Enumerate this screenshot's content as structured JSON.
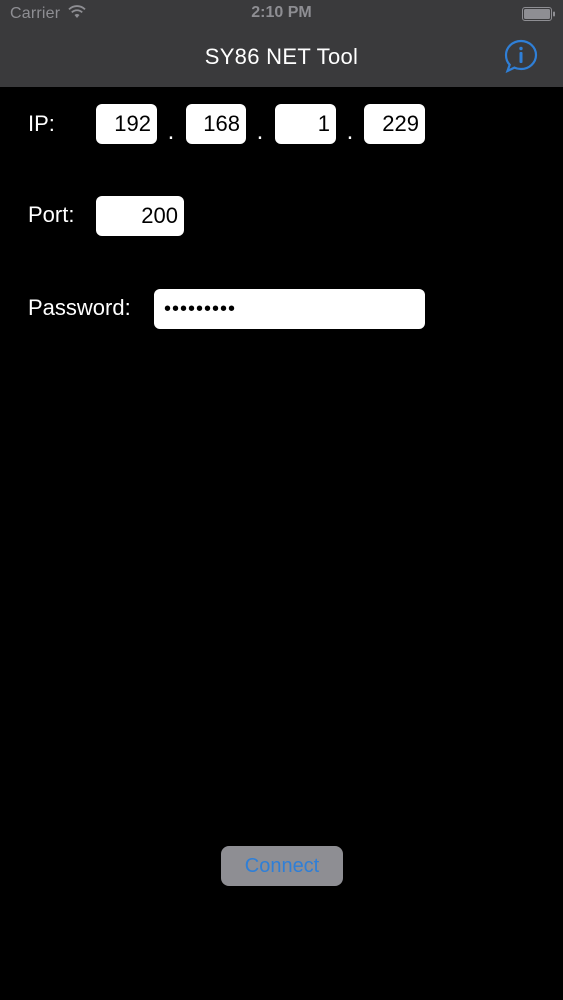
{
  "status_bar": {
    "carrier": "Carrier",
    "time": "2:10 PM",
    "wifi_icon": "wifi-icon",
    "battery_icon": "battery-icon"
  },
  "nav_bar": {
    "title": "SY86 NET Tool",
    "info_icon": "info-bubble-icon",
    "info_color": "#2f7fd7"
  },
  "form": {
    "ip_label": "IP:",
    "ip_octets": [
      "192",
      "168",
      "1",
      "229"
    ],
    "ip_separator": ".",
    "port_label": "Port:",
    "port_value": "200",
    "password_label": "Password:",
    "password_masked": "•••••••••"
  },
  "connect_button": {
    "label": "Connect",
    "text_color": "#2f7fd7",
    "background": "#8e8e93"
  },
  "colors": {
    "background": "#000000",
    "nav_background": "#3a3a3c",
    "field_background": "#ffffff",
    "label_text": "#ffffff"
  }
}
